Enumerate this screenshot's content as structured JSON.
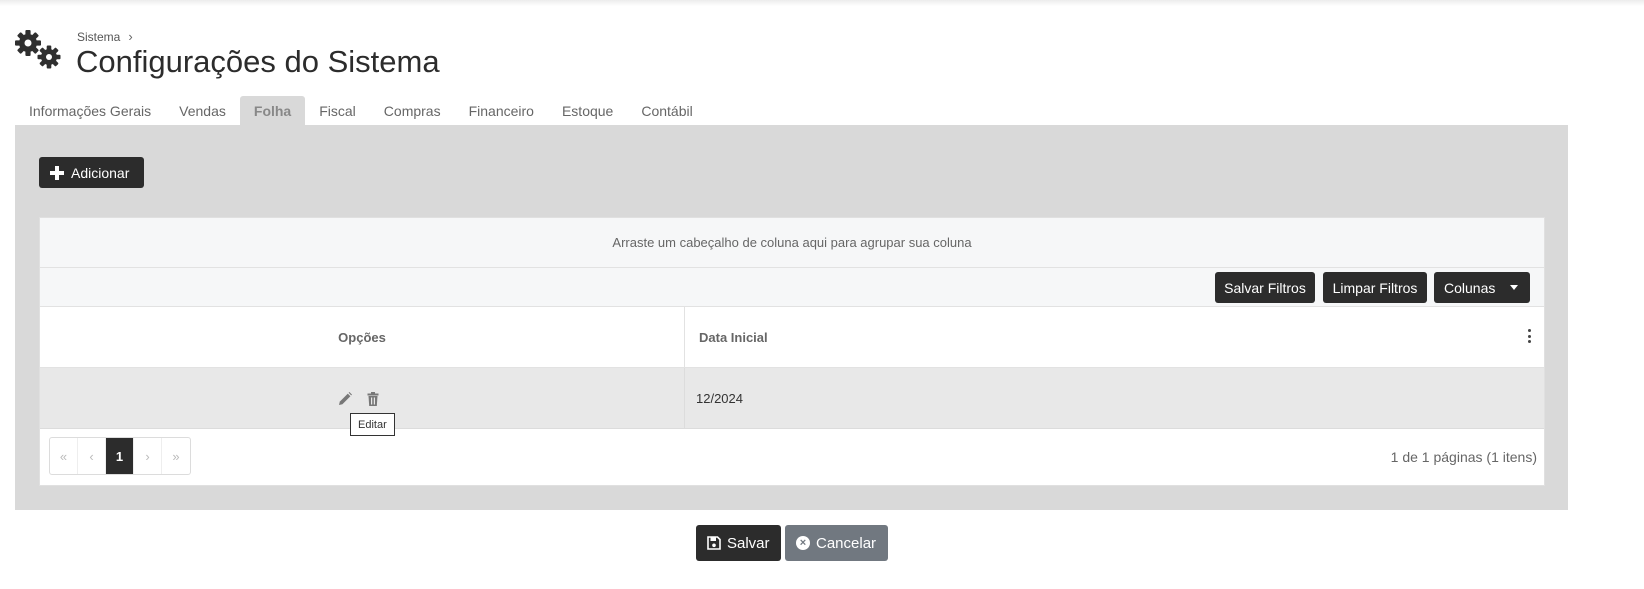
{
  "breadcrumb": {
    "parent": "Sistema",
    "separator": "›"
  },
  "page": {
    "title": "Configurações do Sistema"
  },
  "tabs": [
    {
      "label": "Informações Gerais"
    },
    {
      "label": "Vendas"
    },
    {
      "label": "Folha",
      "active": true
    },
    {
      "label": "Fiscal"
    },
    {
      "label": "Compras"
    },
    {
      "label": "Financeiro"
    },
    {
      "label": "Estoque"
    },
    {
      "label": "Contábil"
    }
  ],
  "actions": {
    "add_label": "Adicionar"
  },
  "grid": {
    "group_hint": "Arraste um cabeçalho de coluna aqui para agrupar sua coluna",
    "toolbar": {
      "save_filters": "Salvar Filtros",
      "clear_filters": "Limpar Filtros",
      "columns": "Colunas"
    },
    "columns": [
      "Opções",
      "Data Inicial"
    ],
    "rows": [
      {
        "data_inicial": "12/2024"
      }
    ],
    "tooltip": "Editar",
    "pager": {
      "current": "1",
      "first": "«",
      "prev": "‹",
      "next": "›",
      "last": "»"
    },
    "page_info": "1 de 1 páginas (1 itens)"
  },
  "footer": {
    "save_label": "Salvar",
    "cancel_label": "Cancelar",
    "cancel_icon": "×"
  },
  "colors": {
    "dark": "#2c2c2c",
    "panel": "#d9d9d9",
    "cancel": "#717880"
  },
  "icons": [
    "gears-icon",
    "plus-icon",
    "edit-icon",
    "trash-icon",
    "kebab-menu-icon",
    "save-icon",
    "close-circle-icon",
    "chevron-right-icon",
    "caret-down-icon"
  ]
}
